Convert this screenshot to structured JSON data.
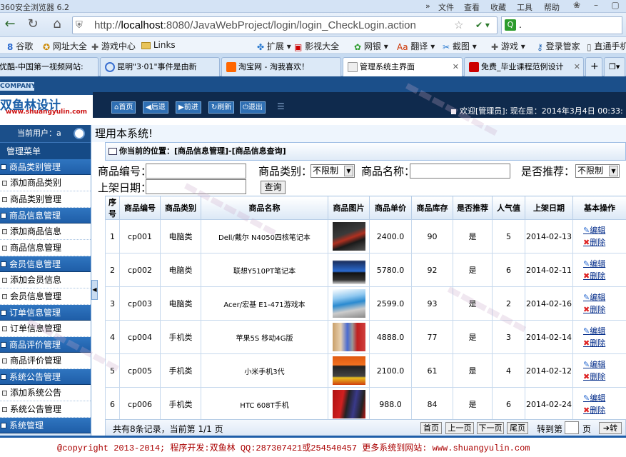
{
  "browser": {
    "app_title": "360安全浏览器 6.2",
    "menus": [
      "文件",
      "查看",
      "收藏",
      "工具",
      "帮助"
    ],
    "url_host": "localhost",
    "url_rest": ":8080/JavaWebProject/login/login_CheckLogin.action",
    "search_text": "."
  },
  "bookmarks": [
    "谷歌",
    "网址大全",
    "游戏中心",
    "Links",
    "扩展",
    "影视大全",
    "网银",
    "翻译",
    "截图",
    "游戏",
    "登录管家",
    "直通手机"
  ],
  "tabs": [
    {
      "label": "优酷-中国第一视频网站:",
      "active": false
    },
    {
      "label": "昆明\"3·01\"事件是由新",
      "active": false
    },
    {
      "label": "淘宝网 - 淘我喜欢！",
      "active": false
    },
    {
      "label": "管理系统主界面",
      "active": true
    },
    {
      "label": "免费_毕业课程范例设计",
      "active": false
    }
  ],
  "header": {
    "company": "COMPANY",
    "logo_text": "双鱼林设计",
    "logo_sub": "www.shuangyulin.com",
    "buttons": [
      "首页",
      "后退",
      "前进",
      "刷新",
      "退出"
    ],
    "welcome": "欢迎[管理员]:  现在是：2014年3月4日 00:33:"
  },
  "marquee": "理用本系统!",
  "sidebar": {
    "current_user": "当前用户：a",
    "menu_title": "管理菜单",
    "groups": [
      {
        "title": "商品类别管理",
        "items": [
          "添加商品类别",
          "商品类别管理"
        ]
      },
      {
        "title": "商品信息管理",
        "items": [
          "添加商品信息",
          "商品信息管理"
        ]
      },
      {
        "title": "会员信息管理",
        "items": [
          "添加会员信息",
          "会员信息管理"
        ]
      },
      {
        "title": "订单信息管理",
        "items": [
          "订单信息管理"
        ]
      },
      {
        "title": "商品评价管理",
        "items": [
          "商品评价管理"
        ]
      },
      {
        "title": "系统公告管理",
        "items": [
          "添加系统公告",
          "系统公告管理"
        ]
      },
      {
        "title": "系统管理",
        "items": []
      }
    ]
  },
  "content": {
    "breadcrumb": "你当前的位置：[商品信息管理]-[商品信息查询]",
    "filters": {
      "code_label": "商品编号：",
      "category_label": "商品类别：",
      "category_value": "不限制",
      "name_label": "商品名称：",
      "recommend_label": "是否推荐：",
      "recommend_value": "不限制",
      "date_label": "上架日期：",
      "query_button": "查询"
    },
    "table": {
      "headers": [
        "序号",
        "商品编号",
        "商品类别",
        "商品名称",
        "商品图片",
        "商品单价",
        "商品库存",
        "是否推荐",
        "人气值",
        "上架日期",
        "基本操作"
      ],
      "rows": [
        {
          "no": "1",
          "code": "cp001",
          "category": "电脑类",
          "name": "Dell/戴尔 N4050四核笔记本",
          "price": "2400.0",
          "stock": "90",
          "recommend": "是",
          "popularity": "5",
          "date": "2014-02-13",
          "edit": "编辑",
          "delete": "删除"
        },
        {
          "no": "2",
          "code": "cp002",
          "category": "电脑类",
          "name": "联想Y510PT笔记本",
          "price": "5780.0",
          "stock": "92",
          "recommend": "是",
          "popularity": "6",
          "date": "2014-02-11",
          "edit": "编辑",
          "delete": "删除"
        },
        {
          "no": "3",
          "code": "cp003",
          "category": "电脑类",
          "name": "Acer/宏基 E1-471游戏本",
          "price": "2599.0",
          "stock": "93",
          "recommend": "是",
          "popularity": "2",
          "date": "2014-02-16",
          "edit": "编辑",
          "delete": "删除"
        },
        {
          "no": "4",
          "code": "cp004",
          "category": "手机类",
          "name": "苹果5S 移动4G版",
          "price": "4888.0",
          "stock": "77",
          "recommend": "是",
          "popularity": "3",
          "date": "2014-02-14",
          "edit": "编辑",
          "delete": "删除"
        },
        {
          "no": "5",
          "code": "cp005",
          "category": "手机类",
          "name": "小米手机3代",
          "price": "2100.0",
          "stock": "61",
          "recommend": "是",
          "popularity": "4",
          "date": "2014-02-12",
          "edit": "编辑",
          "delete": "删除"
        },
        {
          "no": "6",
          "code": "cp006",
          "category": "手机类",
          "name": "HTC 608T手机",
          "price": "988.0",
          "stock": "84",
          "recommend": "是",
          "popularity": "6",
          "date": "2014-02-24",
          "edit": "编辑",
          "delete": "删除"
        }
      ]
    },
    "pager": {
      "summary": "共有8条记录，当前第 1/1 页",
      "first": "首页",
      "prev": "上一页",
      "next": "下一页",
      "last": "尾页",
      "goto_label": "转到第",
      "page_unit": "页",
      "go": "转"
    }
  },
  "footer": "@copyright 2013-2014; 程序开发:双鱼林  QQ:287307421或254540457  更多系统到网站: www.shuangyulin.com"
}
